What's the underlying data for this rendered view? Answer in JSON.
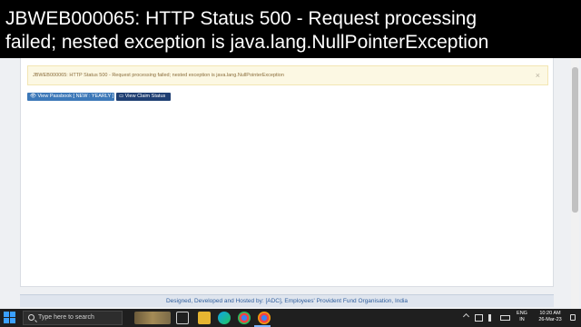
{
  "caption": {
    "line1": "JBWEB000065: HTTP Status 500 - Request processing",
    "line2": "failed; nested exception is java.lang.NullPointerException"
  },
  "alert": {
    "message": "JBWEB000065: HTTP Status 500 - Request processing failed; nested exception is java.lang.NullPointerException",
    "close_glyph": "×"
  },
  "buttons": {
    "passbook": "View Passbook [ NEW : YEARLY ]",
    "claim": "View Claim Status",
    "passbook_icon": "eye-icon",
    "claim_icon": "card-icon"
  },
  "footer": {
    "text": "Designed, Developed and Hosted by: [ADC], Employees' Provident Fund Organisation, India"
  },
  "taskbar": {
    "search_placeholder": "Type here to search",
    "lang_line1": "ENG",
    "lang_line2": "IN",
    "time": "10:20 AM",
    "date": "26-Mar-23"
  }
}
